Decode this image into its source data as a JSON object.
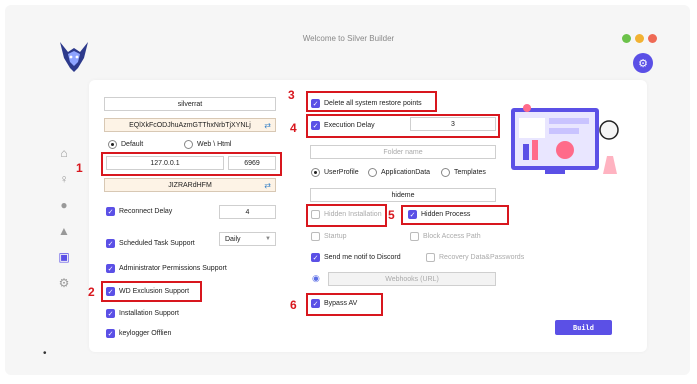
{
  "window": {
    "title": "Welcome to Silver Builder"
  },
  "colors": {
    "accent": "#5b50e6",
    "highlight": "#d8171e",
    "dot_green": "#6cc24a",
    "dot_yellow": "#f2b233",
    "dot_red": "#ef6a55"
  },
  "sidebar": {
    "items": [
      "home-icon",
      "bulb-icon",
      "user-icon",
      "bell-icon",
      "build-icon",
      "gear-icon"
    ]
  },
  "left": {
    "name_value": "silverrat",
    "key_value": "EQlXkFcODJhuAzmGTThxNrbTjXYNLj",
    "radio_default": "Default",
    "radio_web": "Web \\ Html",
    "ip_value": "127.0.0.1",
    "port_value": "6969",
    "mutex_value": "JIZRARdHFM",
    "reconnect_label": "Reconnect Delay",
    "reconnect_value": "4",
    "scheduled_label": "Scheduled Task Support",
    "scheduled_option": "Daily",
    "admin_label": "Administrator Permissions Support",
    "wd_label": "WD Exclusion Support",
    "install_label": "Installation Support",
    "keylogger_label": "keylogger Offlien"
  },
  "right": {
    "restore_label": "Delete all system restore points",
    "exec_label": "Execution Delay",
    "exec_value": "3",
    "folder_placeholder": "Folder name",
    "radio_userprofile": "UserProfile",
    "radio_appdata": "ApplicationData",
    "radio_templates": "Templates",
    "hide_value": "hideme",
    "hidden_install_label": "Hidden Installation",
    "hidden_process_label": "Hidden Process",
    "startup_label": "Startup",
    "block_label": "Block Access Path",
    "discord_label": "Send me notif to Discord",
    "recovery_label": "Recovery Data&Passwords",
    "webhook_placeholder": "Webhooks (URL)",
    "bypass_label": "Bypass AV",
    "build_label": "Build"
  },
  "annotations": [
    "1",
    "2",
    "3",
    "4",
    "5",
    "6"
  ]
}
